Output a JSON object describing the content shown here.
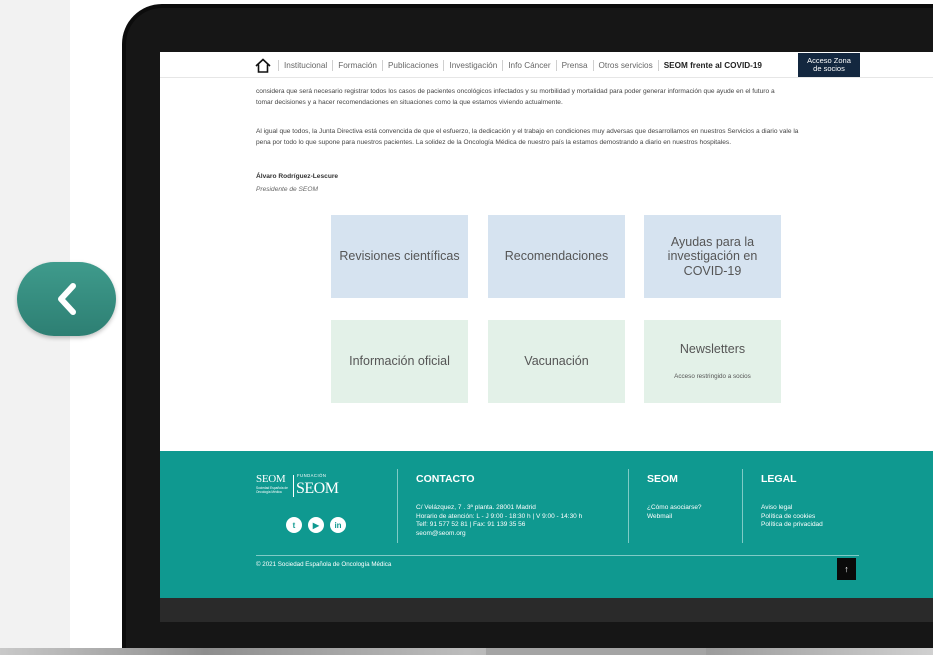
{
  "nav": {
    "items": [
      "Institucional",
      "Formación",
      "Publicaciones",
      "Investigación",
      "Info Cáncer",
      "Prensa",
      "Otros servicios",
      "SEOM frente al COVID-19"
    ],
    "acceso_line1": "Acceso Zona",
    "acceso_line2": "de socios"
  },
  "article": {
    "p1_line1": "considera que será necesario registrar todos los casos de pacientes oncológicos infectados y su morbilidad y mortalidad para poder generar información que ayude en el futuro a",
    "p1_line2": "tomar decisiones y a hacer recomendaciones  en situaciones como la que estamos viviendo actualmente.",
    "p2_line1": "Al igual que todos, la Junta Directiva está convencida de que el esfuerzo, la dedicación y el trabajo en condiciones muy adversas que desarrollamos en nuestros Servicios a diario vale la",
    "p2_line2": "pena por todo lo que supone para nuestros pacientes. La solidez de la Oncología Médica de nuestro país la estamos demostrando a diario en nuestros hospitales.",
    "author": "Álvaro Rodríguez-Lescure",
    "role": "Presidente de SEOM"
  },
  "tiles": {
    "revisiones": "Revisiones científicas",
    "recomendaciones": "Recomendaciones",
    "ayudas": "Ayudas para la investigación en COVID-19",
    "informacion": "Información oficial",
    "vacunacion": "Vacunación",
    "newsletters": "Newsletters",
    "newsletters_sub": "Acceso restringido a socios"
  },
  "footer": {
    "logo_left": "SEOM",
    "logo_left_sub": "Sociedad Española de Oncología Médica",
    "logo_right_small": "FUNDACIÓN",
    "logo_right": "SEOM",
    "social": [
      "twitter-icon",
      "youtube-icon",
      "linkedin-icon"
    ],
    "social_twitter": "t",
    "social_youtube": "▶",
    "social_linkedin": "in",
    "contacto_title": "CONTACTO",
    "contacto_lines": [
      "C/ Velázquez, 7 . 3ª planta. 28001 Madrid",
      "Horario de atención: L - J  9:00 - 18:30 h | V  9:00 - 14:30 h",
      "Telf: 91 577 52 81 | Fax: 91 139 35 56",
      "seom@seom.org"
    ],
    "seom_title": "SEOM",
    "seom_links": [
      "¿Cómo asociarse?",
      "Webmail"
    ],
    "legal_title": "LEGAL",
    "legal_links": [
      "Aviso legal",
      "Política de cookies",
      "Política de privacidad"
    ],
    "copyright": "© 2021 Sociedad Española de Oncología Médica",
    "up_arrow": "↑"
  },
  "colors": {
    "footer_teal": "#0f9990",
    "acceso_navy": "#13273f",
    "tile_blue": "#d6e3f0",
    "tile_green": "#e3f1e8",
    "back_button": "#338a7d"
  }
}
